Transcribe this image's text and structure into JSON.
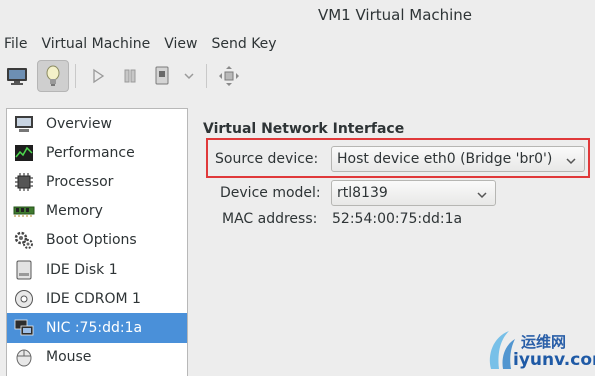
{
  "window": {
    "title": "VM1 Virtual Machine"
  },
  "menubar": {
    "items": [
      "File",
      "Virtual Machine",
      "View",
      "Send Key"
    ]
  },
  "toolbar": {
    "buttons": [
      "console-icon",
      "details-icon",
      "run-icon",
      "pause-icon",
      "shutdown-icon",
      "dropdown-icon",
      "fullscreen-icon"
    ],
    "active": "details-icon"
  },
  "sidebar": {
    "items": [
      {
        "label": "Overview",
        "icon": "overview-icon"
      },
      {
        "label": "Performance",
        "icon": "performance-icon"
      },
      {
        "label": "Processor",
        "icon": "processor-icon"
      },
      {
        "label": "Memory",
        "icon": "memory-icon"
      },
      {
        "label": "Boot Options",
        "icon": "boot-options-icon"
      },
      {
        "label": "IDE Disk 1",
        "icon": "disk-icon"
      },
      {
        "label": "IDE CDROM 1",
        "icon": "cdrom-icon"
      },
      {
        "label": "NIC :75:dd:1a",
        "icon": "nic-icon",
        "selected": true
      },
      {
        "label": "Mouse",
        "icon": "mouse-icon"
      }
    ]
  },
  "nic": {
    "section_title": "Virtual Network Interface",
    "source_device_label": "Source device:",
    "source_device_value": "Host device eth0 (Bridge 'br0')",
    "device_model_label": "Device model:",
    "device_model_value": "rtl8139",
    "mac_address_label": "MAC address:",
    "mac_address_value": "52:54:00:75:dd:1a"
  },
  "watermark": {
    "text_cn": "运维网",
    "text_en": "iyunv.com"
  },
  "colors": {
    "selection": "#4a90d9",
    "highlight_box": "#e0393a"
  }
}
